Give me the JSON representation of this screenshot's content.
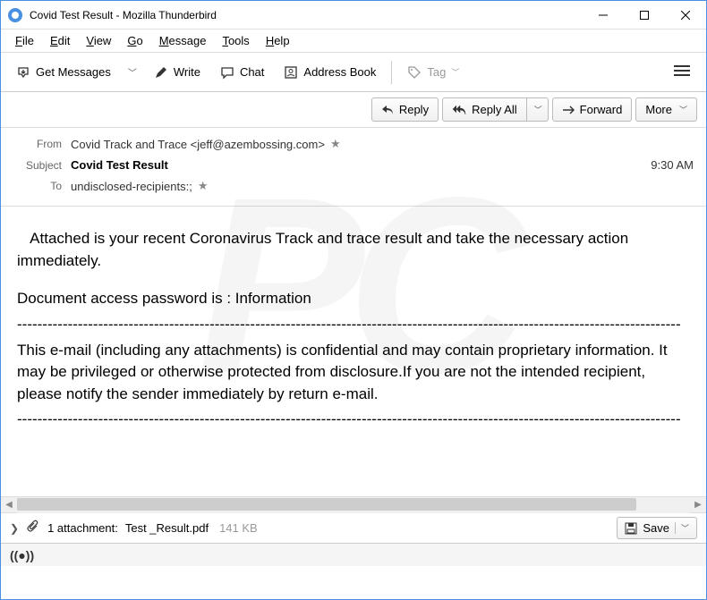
{
  "window": {
    "title": "Covid Test Result - Mozilla Thunderbird"
  },
  "menubar": [
    {
      "u": "F",
      "rest": "ile"
    },
    {
      "u": "E",
      "rest": "dit"
    },
    {
      "u": "V",
      "rest": "iew"
    },
    {
      "u": "G",
      "rest": "o"
    },
    {
      "u": "M",
      "rest": "essage"
    },
    {
      "u": "T",
      "rest": "ools"
    },
    {
      "u": "H",
      "rest": "elp"
    }
  ],
  "toolbar": {
    "get_messages": "Get Messages",
    "write": "Write",
    "chat": "Chat",
    "address_book": "Address Book",
    "tag": "Tag"
  },
  "actions": {
    "reply": "Reply",
    "reply_all": "Reply All",
    "forward": "Forward",
    "more": "More"
  },
  "headers": {
    "from_label": "From",
    "from_value": "Covid Track and Trace <jeff@azembossing.com>",
    "subject_label": "Subject",
    "subject_value": "Covid Test Result",
    "to_label": "To",
    "to_value": "undisclosed-recipients:;",
    "time": "9:30 AM"
  },
  "body": {
    "p1": "   Attached is your recent Coronavirus Track and trace result and take the necessary action immediately.",
    "p2": "Document access password is : Information",
    "p3": "This e-mail (including any attachments) is confidential and may contain proprietary information. It may be privileged or otherwise protected from disclosure.If you are not the intended recipient, please notify the sender immediately by return e-mail.",
    "dashes": "-----------------------------------------------------------------------------------------------------------------------------------"
  },
  "attachment": {
    "count_label": "1 attachment:",
    "filename": "Test _Result.pdf",
    "size": "141 KB",
    "save": "Save"
  },
  "status": {
    "connection": "((●))"
  }
}
